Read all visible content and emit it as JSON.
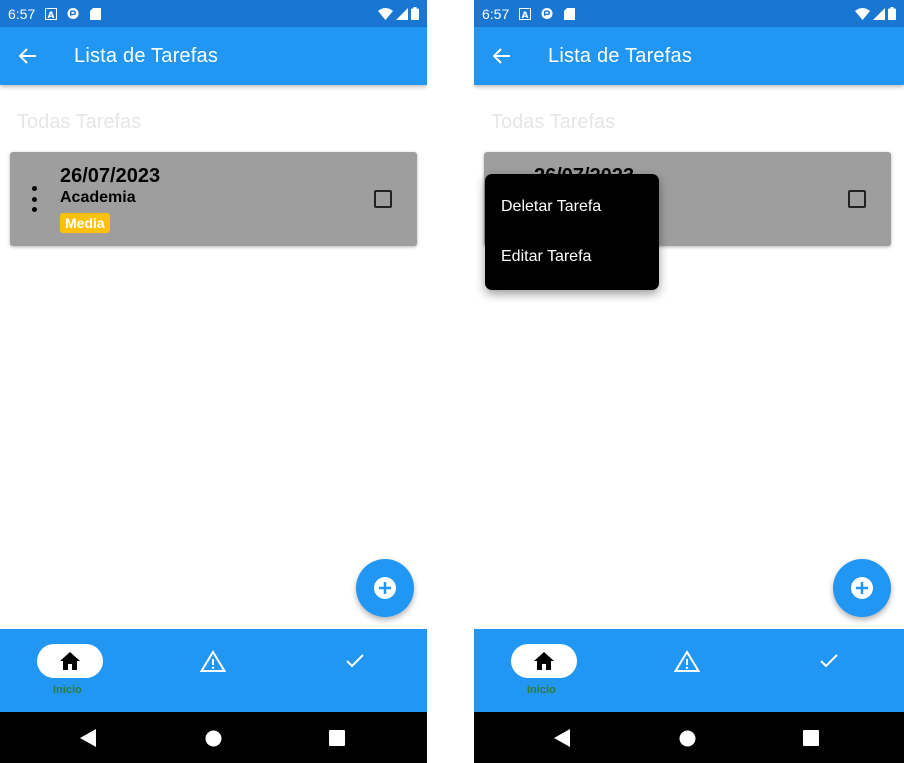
{
  "status": {
    "time": "6:57"
  },
  "appbar": {
    "title": "Lista de Tarefas"
  },
  "section": {
    "title": "Todas Tarefas"
  },
  "task": {
    "date": "26/07/2023",
    "name": "Academia",
    "priority": "Media",
    "priority_color": "#ffc107",
    "completed": false
  },
  "popup_menu": {
    "items": [
      "Deletar Tarefa",
      "Editar Tarefa"
    ]
  },
  "bottom_nav": {
    "active_label": "Inicio",
    "items": [
      "home-icon",
      "warning-icon",
      "check-icon"
    ]
  },
  "colors": {
    "primary": "#2196f3",
    "status_bar": "#1976d2",
    "card": "#9e9e9e",
    "nav_label": "#2e7d32"
  }
}
